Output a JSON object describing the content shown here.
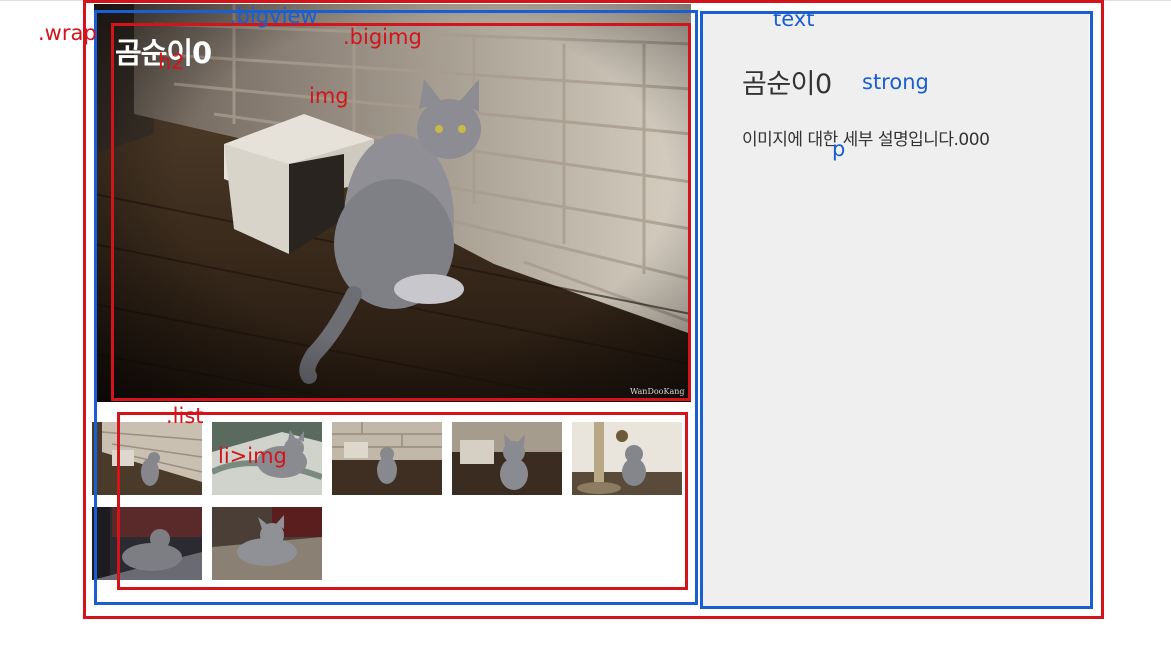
{
  "annotations": {
    "wrap": ".wrap",
    "bigview": ".bigview",
    "bigimg": ".bigimg",
    "h2": "h2",
    "img": "img",
    "list": ".list",
    "li_img": "li>img",
    "text": "text",
    "strong": "strong",
    "p": "p"
  },
  "bigview": {
    "title": "곰순이0",
    "watermark": "WanDooKang"
  },
  "detail": {
    "title": "곰순이0",
    "description": "이미지에 대한 세부 설명입니다.000"
  },
  "thumbnails": [
    {
      "name": "cat-by-brick-wall"
    },
    {
      "name": "cat-on-blanket"
    },
    {
      "name": "cat-sitting-front"
    },
    {
      "name": "cat-front-closeup"
    },
    {
      "name": "cat-by-scratching-post"
    },
    {
      "name": "cat-lying-shadow"
    },
    {
      "name": "cat-lying-blanket"
    }
  ],
  "colors": {
    "annotation_red": "#d3141a",
    "annotation_blue": "#1a5fd1",
    "panel_bg": "#efefef"
  }
}
